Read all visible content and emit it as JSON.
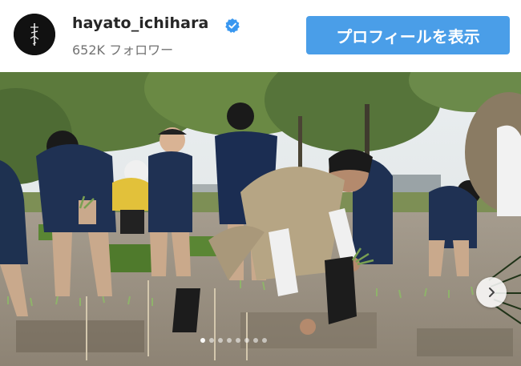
{
  "profile": {
    "username": "hayato_ichihara",
    "followers": "652K フォロワー",
    "verified": true,
    "avatar_icon": "calligraphy-logo-icon"
  },
  "actions": {
    "view_profile_label": "プロフィールを表示"
  },
  "carousel": {
    "next_icon": "chevron-right-icon",
    "dot_count": 8,
    "active_dot": 0
  },
  "colors": {
    "button_bg": "#4a9ee8",
    "verified_badge": "#3897f0",
    "username": "#262626",
    "muted_text": "#737373"
  }
}
